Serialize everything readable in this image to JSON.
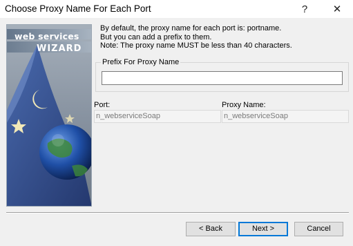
{
  "window": {
    "title": "Choose Proxy Name For Each Port",
    "help_glyph": "?",
    "close_glyph": "✕"
  },
  "sidebar": {
    "line1": "web services",
    "line2": "WIZARD"
  },
  "info": {
    "line1": "By default, the proxy name for each port is: portname.",
    "line2": "But you can add a prefix to them.",
    "line3": "Note: The proxy name MUST be less than 40 characters."
  },
  "prefix": {
    "legend": "Prefix For Proxy Name",
    "value": ""
  },
  "table": {
    "headers": [
      "Port:",
      "Proxy Name:"
    ],
    "rows": [
      [
        "n_webserviceSoap",
        "n_webserviceSoap"
      ]
    ]
  },
  "buttons": {
    "back": "< Back",
    "next": "Next >",
    "cancel": "Cancel"
  },
  "colors": {
    "default_button_border": "#0078d7"
  }
}
